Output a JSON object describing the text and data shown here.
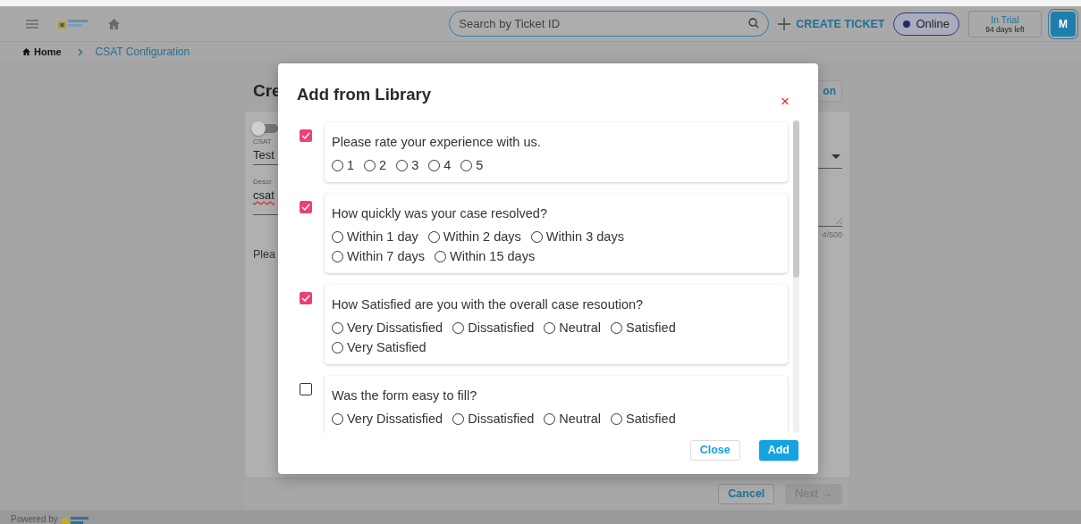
{
  "topbar": {
    "search": {
      "placeholder": "Search by Ticket ID"
    },
    "create_ticket": "CREATE TICKET",
    "status": "Online",
    "trial": {
      "title": "In Trial",
      "days": "94 days left"
    },
    "avatar": "M"
  },
  "breadcrumb": [
    {
      "label": "Home"
    },
    {
      "label": "CSAT Configuration"
    }
  ],
  "background_form": {
    "title": "Cre",
    "header_button": "on",
    "toggle": {
      "on": false
    },
    "field_label": "CSAT",
    "field_value": "Test",
    "description_label": "Descr",
    "description_value": "csat",
    "counter": "4/500",
    "prompt": "Plea"
  },
  "form_buttons": [
    {
      "label": "Cancel",
      "disabled": false
    },
    {
      "label": "Next →",
      "disabled": true
    }
  ],
  "footer": {
    "text": "Powered by"
  },
  "dialog": {
    "title": "Add from Library",
    "close": "×",
    "questions": [
      {
        "text": "Please rate your experience with us.",
        "checked": true,
        "options": [
          "1",
          "2",
          "3",
          "4",
          "5"
        ]
      },
      {
        "text": "How quickly was your case resolved?",
        "checked": true,
        "options": [
          "Within 1 day",
          "Within 2 days",
          "Within 3 days",
          "Within 7 days",
          "Within 15 days"
        ]
      },
      {
        "text": "How Satisfied are you with the overall case resoution?",
        "checked": true,
        "options": [
          "Very Dissatisfied",
          "Dissatisfied",
          "Neutral",
          "Satisfied",
          "Very Satisfied"
        ]
      },
      {
        "text": "Was the form easy to fill?",
        "checked": false,
        "options": [
          "Very Dissatisfied",
          "Dissatisfied",
          "Neutral",
          "Satisfied"
        ]
      }
    ],
    "buttons": [
      {
        "label": "Close",
        "kind": "secondary"
      },
      {
        "label": "Add",
        "kind": "primary"
      }
    ]
  }
}
